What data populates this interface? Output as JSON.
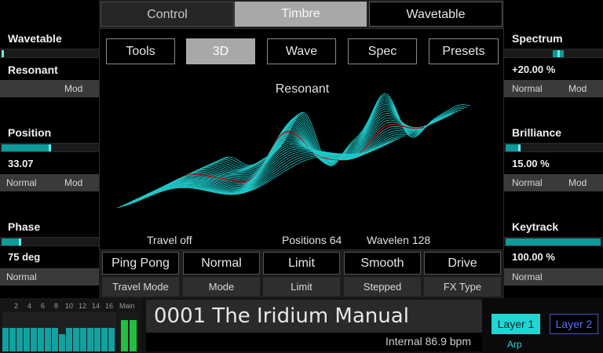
{
  "tabs": [
    "Control",
    "Timbre",
    "Wavetable"
  ],
  "view_buttons": [
    "Tools",
    "3D",
    "Wave",
    "Spec",
    "Presets"
  ],
  "viewer": {
    "title": "Resonant",
    "travel": "Travel off",
    "positions": "Positions 64",
    "wavelen": "Wavelen 128"
  },
  "left_panel": [
    {
      "label": "Wavetable",
      "level": 0.03
    },
    {
      "label": "Resonant",
      "mod": "Mod"
    },
    {
      "label": "Position",
      "level": 0.52
    },
    {
      "value": "33.07",
      "mode": "Normal",
      "mod": "Mod"
    },
    {
      "label": "Phase",
      "level": 0.2
    },
    {
      "value": "75 deg",
      "mode": "Normal"
    }
  ],
  "right_panel": [
    {
      "label": "Spectrum",
      "level": 0.55
    },
    {
      "value": "+20.00 %",
      "mode": "Normal",
      "mod": "Mod"
    },
    {
      "label": "Brilliance",
      "level": 0.15
    },
    {
      "value": "15.00 %",
      "mode": "Normal",
      "mod": "Mod"
    },
    {
      "label": "Keytrack",
      "level": 1.0
    },
    {
      "value": "100.00 %",
      "mode": "Normal"
    }
  ],
  "params": [
    {
      "value": "Ping Pong",
      "label": "Travel Mode"
    },
    {
      "value": "Normal",
      "label": "Mode"
    },
    {
      "value": "Limit",
      "label": "Limit"
    },
    {
      "value": "Smooth",
      "label": "Stepped"
    },
    {
      "value": "Drive",
      "label": "FX Type"
    }
  ],
  "mixer": {
    "numbers": [
      "2",
      "4",
      "6",
      "8",
      "10",
      "12",
      "14",
      "16"
    ],
    "main": "Main"
  },
  "preset": {
    "name": "0001 The Iridium Manual",
    "status": "Internal 86.9 bpm"
  },
  "layers": {
    "layer1": "Layer 1",
    "layer2": "Layer 2",
    "arp": "Arp"
  },
  "colors": {
    "accent": "#22d4d4",
    "wave": "#1fc9c9",
    "highlight_wave": "#b0181e",
    "meter": "#22c042"
  }
}
